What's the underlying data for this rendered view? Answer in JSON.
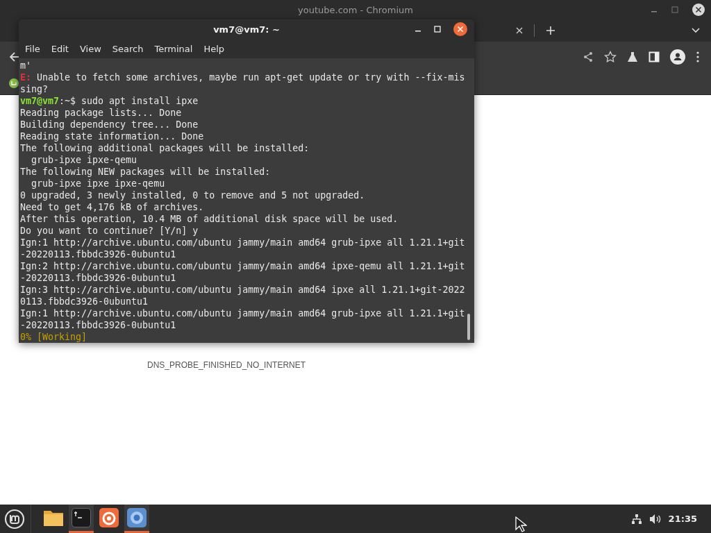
{
  "browser": {
    "title": "youtube.com - Chromium",
    "error_code": "DNS_PROBE_FINISHED_NO_INTERNET"
  },
  "terminal": {
    "title": "vm7@vm7: ~",
    "menu": [
      "File",
      "Edit",
      "View",
      "Search",
      "Terminal",
      "Help"
    ],
    "lines": [
      {
        "kind": "plain",
        "text": "m'"
      },
      {
        "kind": "error",
        "prefix": "E:",
        "text": " Unable to fetch some archives, maybe run apt-get update or try with --fix-mis"
      },
      {
        "kind": "plain",
        "text": "sing?"
      },
      {
        "kind": "prompt",
        "prefix": "vm7@vm7",
        "text": ":~$ sudo apt install ipxe"
      },
      {
        "kind": "plain",
        "text": "Reading package lists... Done"
      },
      {
        "kind": "plain",
        "text": "Building dependency tree... Done"
      },
      {
        "kind": "plain",
        "text": "Reading state information... Done"
      },
      {
        "kind": "plain",
        "text": "The following additional packages will be installed:"
      },
      {
        "kind": "plain",
        "text": "  grub-ipxe ipxe-qemu"
      },
      {
        "kind": "plain",
        "text": "The following NEW packages will be installed:"
      },
      {
        "kind": "plain",
        "text": "  grub-ipxe ipxe ipxe-qemu"
      },
      {
        "kind": "plain",
        "text": "0 upgraded, 3 newly installed, 0 to remove and 5 not upgraded."
      },
      {
        "kind": "plain",
        "text": "Need to get 4,176 kB of archives."
      },
      {
        "kind": "plain",
        "text": "After this operation, 10.4 MB of additional disk space will be used."
      },
      {
        "kind": "plain",
        "text": "Do you want to continue? [Y/n] y"
      },
      {
        "kind": "plain",
        "text": "Ign:1 http://archive.ubuntu.com/ubuntu jammy/main amd64 grub-ipxe all 1.21.1+git"
      },
      {
        "kind": "plain",
        "text": "-20220113.fbbdc3926-0ubuntu1"
      },
      {
        "kind": "plain",
        "text": "Ign:2 http://archive.ubuntu.com/ubuntu jammy/main amd64 ipxe-qemu all 1.21.1+git"
      },
      {
        "kind": "plain",
        "text": "-20220113.fbbdc3926-0ubuntu1"
      },
      {
        "kind": "plain",
        "text": "Ign:3 http://archive.ubuntu.com/ubuntu jammy/main amd64 ipxe all 1.21.1+git-2022"
      },
      {
        "kind": "plain",
        "text": "0113.fbbdc3926-0ubuntu1"
      },
      {
        "kind": "plain",
        "text": "Ign:1 http://archive.ubuntu.com/ubuntu jammy/main amd64 grub-ipxe all 1.21.1+git"
      },
      {
        "kind": "plain",
        "text": "-20220113.fbbdc3926-0ubuntu1"
      },
      {
        "kind": "status",
        "text": "0% [Working]"
      }
    ]
  },
  "taskbar": {
    "apps": [
      {
        "kind": "files",
        "active": false
      },
      {
        "kind": "terminal",
        "active": true
      },
      {
        "kind": "firefox",
        "active": false
      },
      {
        "kind": "chromium",
        "active": true
      }
    ],
    "clock": "21:35"
  }
}
